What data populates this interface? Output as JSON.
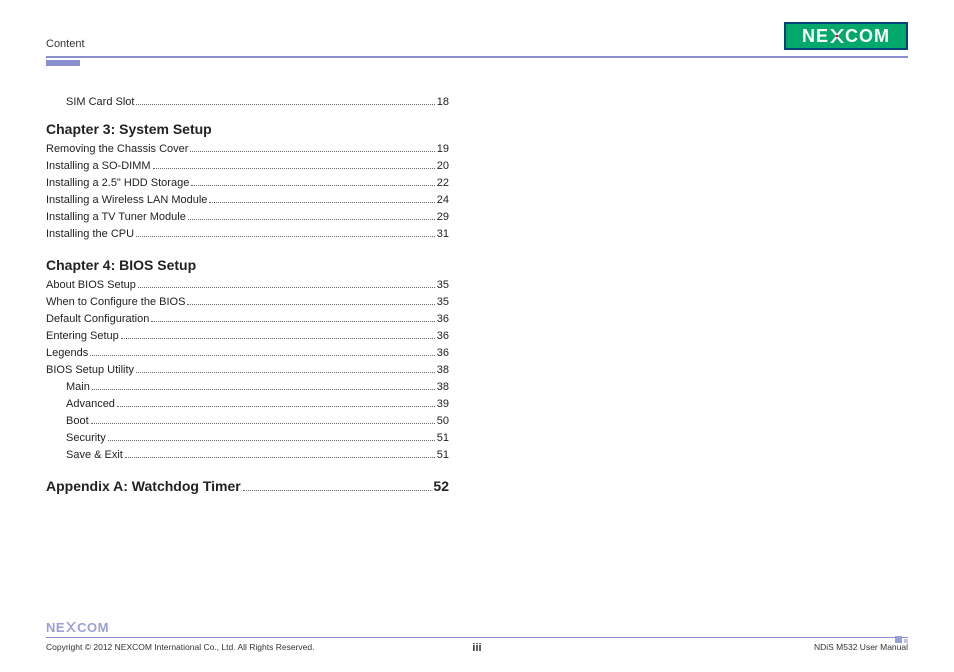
{
  "header": {
    "title": "Content",
    "logo_text_left": "NE",
    "logo_text_right": "COM"
  },
  "toc": {
    "pre_items": [
      {
        "label": "SIM Card Slot",
        "page": "18",
        "indent": 1
      }
    ],
    "chapters": [
      {
        "heading": "Chapter 3: System Setup",
        "items": [
          {
            "label": "Removing the Chassis Cover ",
            "page": "19",
            "indent": 0
          },
          {
            "label": "Installing a SO-DIMM",
            "page": "20",
            "indent": 0
          },
          {
            "label": "Installing a 2.5\" HDD Storage",
            "page": "22",
            "indent": 0
          },
          {
            "label": "Installing a Wireless LAN Module",
            "page": "24",
            "indent": 0
          },
          {
            "label": "Installing a TV Tuner Module",
            "page": "29",
            "indent": 0
          },
          {
            "label": "Installing the CPU",
            "page": "31",
            "indent": 0
          }
        ]
      },
      {
        "heading": "Chapter 4: BIOS Setup",
        "items": [
          {
            "label": "About BIOS Setup",
            "page": "35",
            "indent": 0
          },
          {
            "label": "When to Configure the BIOS",
            "page": "35",
            "indent": 0
          },
          {
            "label": "Default Configuration",
            "page": "36",
            "indent": 0
          },
          {
            "label": "Entering Setup",
            "page": "36",
            "indent": 0
          },
          {
            "label": "Legends",
            "page": "36",
            "indent": 0
          },
          {
            "label": "BIOS Setup Utility",
            "page": "38",
            "indent": 0
          },
          {
            "label": "Main",
            "page": "38",
            "indent": 1
          },
          {
            "label": "Advanced",
            "page": "39",
            "indent": 1
          },
          {
            "label": "Boot",
            "page": "50",
            "indent": 1
          },
          {
            "label": "Security",
            "page": "51",
            "indent": 1
          },
          {
            "label": "Save & Exit",
            "page": "51",
            "indent": 1
          }
        ]
      }
    ],
    "appendix": {
      "label": "Appendix A: Watchdog Timer",
      "page": "52"
    }
  },
  "footer": {
    "copyright": "Copyright © 2012 NEXCOM International Co., Ltd. All Rights Reserved.",
    "page_number": "iii",
    "doc_title": "NDiS M532 User Manual",
    "logo_text_left": "NE",
    "logo_text_right": "COM"
  }
}
